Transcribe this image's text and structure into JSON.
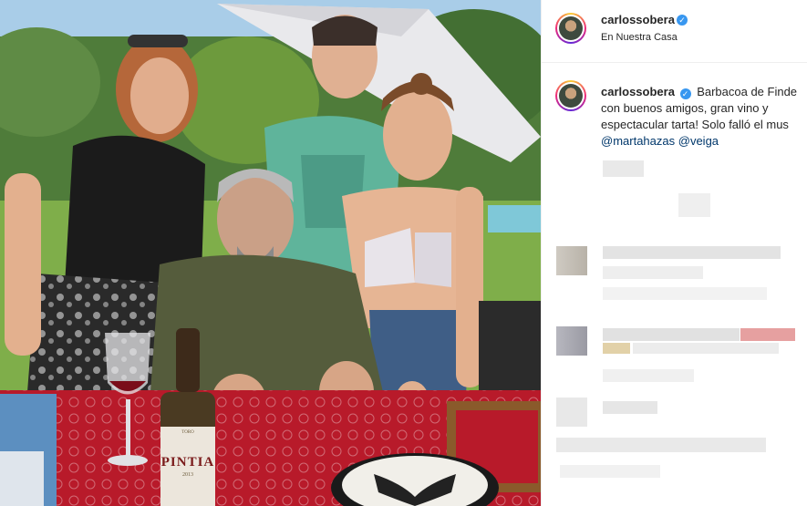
{
  "photo": {
    "bottle_label": "PINTIA",
    "bottle_small": "TORO",
    "bottle_year": "2013"
  },
  "post": {
    "username": "carlossobera",
    "location": "En Nuestra Casa",
    "caption_text": "Barbacoa de Finde con buenos amigos, gran vino y espectacular tarta! Solo falló el mus",
    "mention_1": "@martahazas",
    "mention_2": "@veiga"
  },
  "colors": {
    "verified": "#3897f0",
    "mention": "#00376b",
    "text": "#262626"
  }
}
